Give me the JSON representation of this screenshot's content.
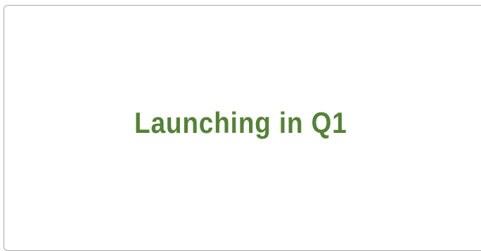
{
  "slide": {
    "headline": "Launching in Q1",
    "headline_color": "#548235",
    "border_color": "#a9a9a9",
    "background_color": "#ffffff"
  }
}
